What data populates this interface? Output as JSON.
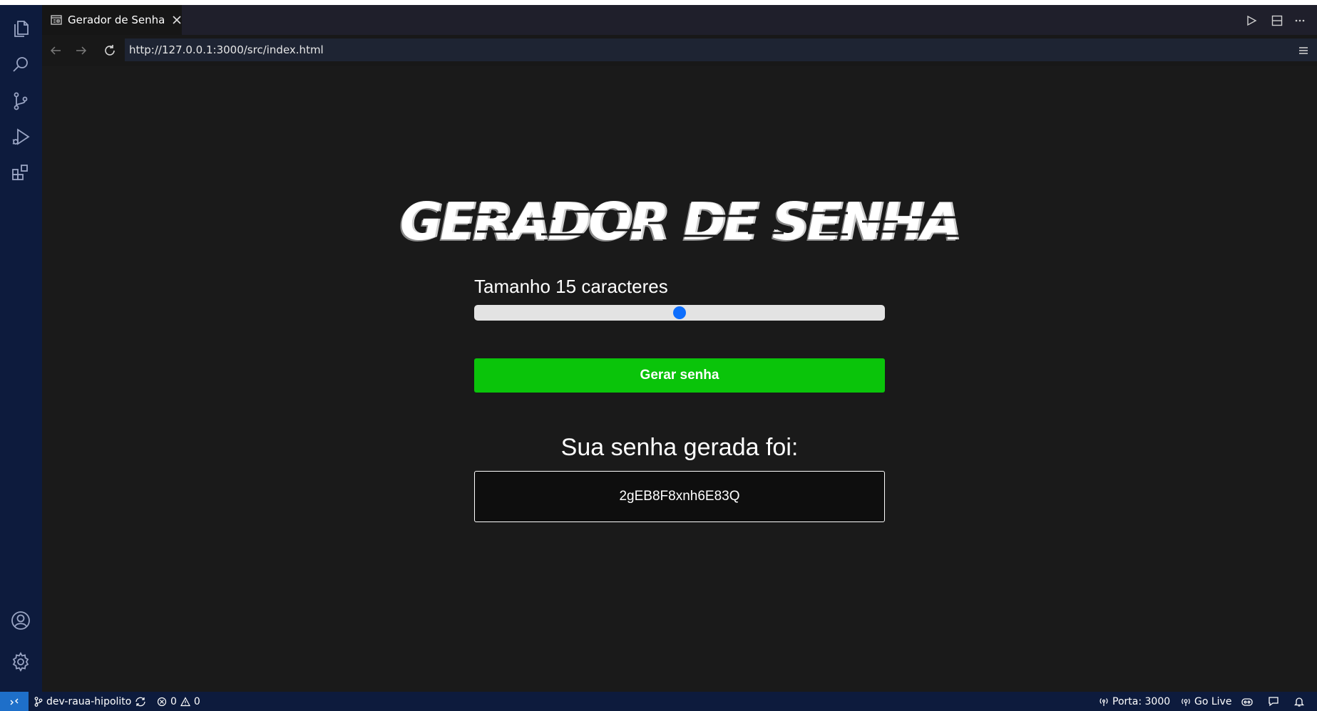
{
  "editor": {
    "tab_title": "Gerador de Senha",
    "url": "http://127.0.0.1:3000/src/index.html"
  },
  "page": {
    "heading": "GERADOR DE SENHA",
    "size_label": "Tamanho 15 caracteres",
    "slider_fraction": 0.5,
    "generate_button": "Gerar senha",
    "result_heading": "Sua senha gerada foi:",
    "password": "2gEB8F8xnh6E83Q"
  },
  "status_bar": {
    "branch": "dev-raua-hipolito",
    "errors": "0",
    "warnings": "0",
    "port": "Porta: 3000",
    "go_live": "Go Live"
  },
  "icons": {
    "activity": [
      "files-icon",
      "search-icon",
      "source-control-icon",
      "run-debug-icon",
      "extensions-icon"
    ],
    "activity_bottom": [
      "account-icon",
      "settings-gear-icon"
    ]
  },
  "colors": {
    "activity_bar": "#0d1b3d",
    "button_green": "#0ac40a",
    "slider_thumb": "#0d6efd",
    "remote_accent": "#1e6fc9"
  }
}
